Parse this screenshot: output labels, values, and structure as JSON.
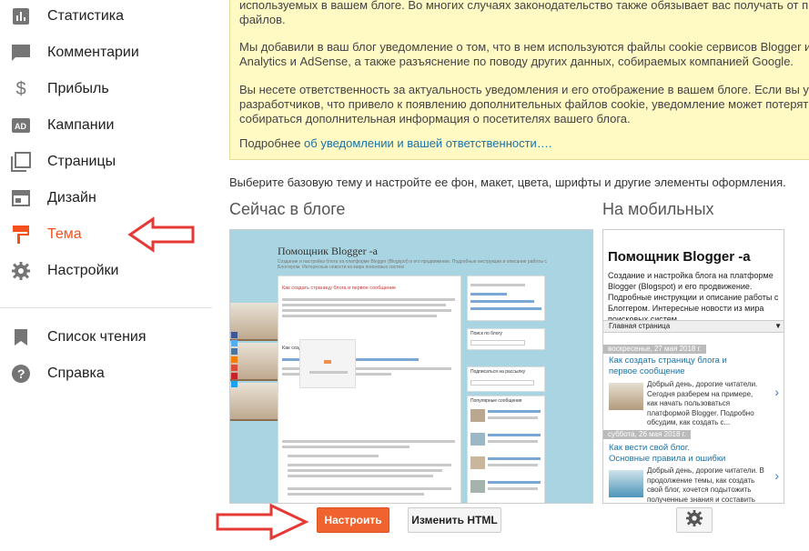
{
  "sidebar": {
    "items": [
      {
        "label": "Статистика",
        "icon": "bar-chart-icon"
      },
      {
        "label": "Комментарии",
        "icon": "comment-icon"
      },
      {
        "label": "Прибыль",
        "icon": "dollar-icon"
      },
      {
        "label": "Кампании",
        "icon": "ad-icon"
      },
      {
        "label": "Страницы",
        "icon": "pages-icon"
      },
      {
        "label": "Дизайн",
        "icon": "layout-icon"
      },
      {
        "label": "Тема",
        "icon": "paint-roller-icon",
        "active": true
      },
      {
        "label": "Настройки",
        "icon": "gear-icon"
      }
    ],
    "bottom_items": [
      {
        "label": "Список чтения",
        "icon": "bookmark-icon"
      },
      {
        "label": "Справка",
        "icon": "help-icon"
      }
    ]
  },
  "notice": {
    "line1": "используемых в вашем блоге. Во многих случаях законодательство также обязывает вас получать от п",
    "line2": "файлов.",
    "line3": "Мы добавили в ваш блог уведомление о том, что в нем используются файлы cookie сервисов Blogger и",
    "line4": "Analytics и AdSense, а также разъяснение по поводу других данных, собираемых компанией Google.",
    "line5": "Вы несете ответственность за актуальность уведомления и его отображение в вашем блоге. Если вы у",
    "line6": "разработчиков, что привело к появлению дополнительных файлов cookie, уведомление может потерят",
    "line7": "собираться дополнительная информация о посетителях вашего блога.",
    "more_prefix": "Подробнее ",
    "more_link": "об уведомлении и вашей ответственности…."
  },
  "intro": "Выберите базовую тему и настройте ее фон, макет, цвета, шрифты и другие элементы оформления.",
  "headings": {
    "current": "Сейчас в блоге",
    "mobile": "На мобильных"
  },
  "preview": {
    "blog_title": "Помощник Blogger -а",
    "blog_subtitle": "Создание и настройка блога на платформе Blogger (Blogspot) и его продвижение. Подробные инструкции и описание работы с Блоггером. Интересные новости из мира поисковых систем",
    "post_title": "Как создать страницу блога и первое сообщение",
    "post_subheading": "Как создать страницу блога?",
    "side_search": "Поиск по блогу",
    "side_subscribe": "Подписаться на рассылку",
    "side_popular": "Популярные сообщения"
  },
  "mobile": {
    "title": "Помощник Blogger -а",
    "description": "Создание и настройка блога на платформе Blogger (Blogspot) и его продвижение. Подробные инструкции и описание работы с Блоггером. Интересные новости из мира поисковых систем",
    "nav": "Главная страница",
    "posts": [
      {
        "date": "воскресенье, 27 мая 2018 г.",
        "title_line1": "Как создать страницу блога и",
        "title_line2": "первое сообщение",
        "excerpt": "Добрый день, дорогие читатели. Сегодня разберем на примере, как начать пользоваться платформой Blogger. Подробно обсудим, как создать с..."
      },
      {
        "date": "суббота, 26 мая 2018 г.",
        "title_line1": "Как вести свой блог.",
        "title_line2": "Основные правила и ошибки",
        "excerpt": "Добрый день, дорогие читатели. В продолжение темы, как создать свой блог, хочется подытожить полученные знания и составить план действия..."
      }
    ]
  },
  "buttons": {
    "customize": "Настроить",
    "edit_html": "Изменить HTML",
    "mobile_settings_icon": "gear-icon"
  },
  "colors": {
    "accent": "#f4511e",
    "arrow": "#e53935",
    "notice_bg": "#fff9c4",
    "link": "#1a73a8"
  }
}
